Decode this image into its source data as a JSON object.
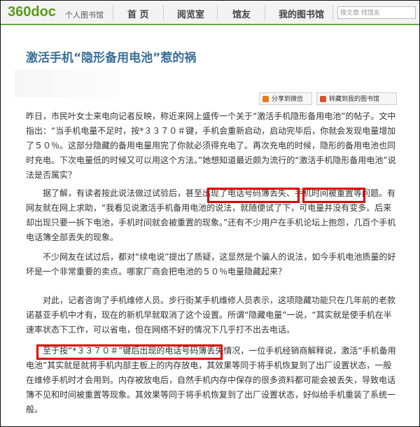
{
  "header": {
    "logo": "360doc",
    "logo_sub": "个人图书馆",
    "nav": [
      "首 页",
      "阅览室",
      "馆友",
      "我的图书馆"
    ],
    "search_placeholder": "搜文章 找馆友"
  },
  "article": {
    "title": "激活手机“隐形备用电池”惹的祸",
    "share_label": "分享到微信",
    "save_label": "转藏到我的图书馆",
    "paragraphs": [
      "昨日，市民叶女士来电向记者反映，称近来网上盛传一个关于“激活手机隐形备用电池”的帖子。文中指出：“当手机电量不足时，按*３３７０＃键，手机会重新启动，启动完毕后，你就会发现电量增加了５０％。这部分隐藏的备用电量用完了你就必须得充电了。再次充电的时候，隐形的备用电池也同时充电。下次电量低的时候又可以用这个方法。”她想知道最近颇为流行的“激活手机隐形备用电池”说法是否属实？",
      "据了解，有读者按此说法做过试验后，甚至出现了电话号码簿丢失、手机时间被重置等问题。有网友就在网上求助，“我看见说激活手机备用电池的说法，就随便试了下，可电量并没有变多。后来却出现只要一拆下电池，手机时间就会被重置的现象。”还有不少用户在手机论坛上抱怨，几百个手机电话簿全部丢失的现象。",
      "不少网友在试过后，都对“续电说”提出了质疑，这显然是个骗人的说法，如今手机电池质量的好坏是一个非常重要的卖点。哪家厂商会把电池的５０％电量隐藏起来？",
      "对此，记者咨询了手机维修人员。步行街某手机维修人员表示，这项隐藏功能只在几年前的老款诺基亚手机中才有，现在的新机早就取消了这个设置。所谓“隐藏电量”一说，“其实就是使手机在半速率状态下工作，可以省电，但在网络不好的情况下几乎打不出去电话。",
      "至于按“*３３７０＃”键后出现的电话号码簿丢失情况，一位手机经销商解释说，激活“手机备用电池”其实就是就将手机内部主板上的内存放电，其效果等同于将手机恢复到了出厂设置状态，一般在维修手机时才会用到。内存被放电后，自然手机内存中保存的很多资料都可能会被丢失，导致电话簿不见和时间被重置等现象。其效果等同于将手机恢复到了出厂设置状态，好似给手机重装了系统一般。"
    ]
  },
  "colors": {
    "accent": "#5a9a1a",
    "title": "#3b6f9a",
    "highlight_box": "#e00000"
  }
}
